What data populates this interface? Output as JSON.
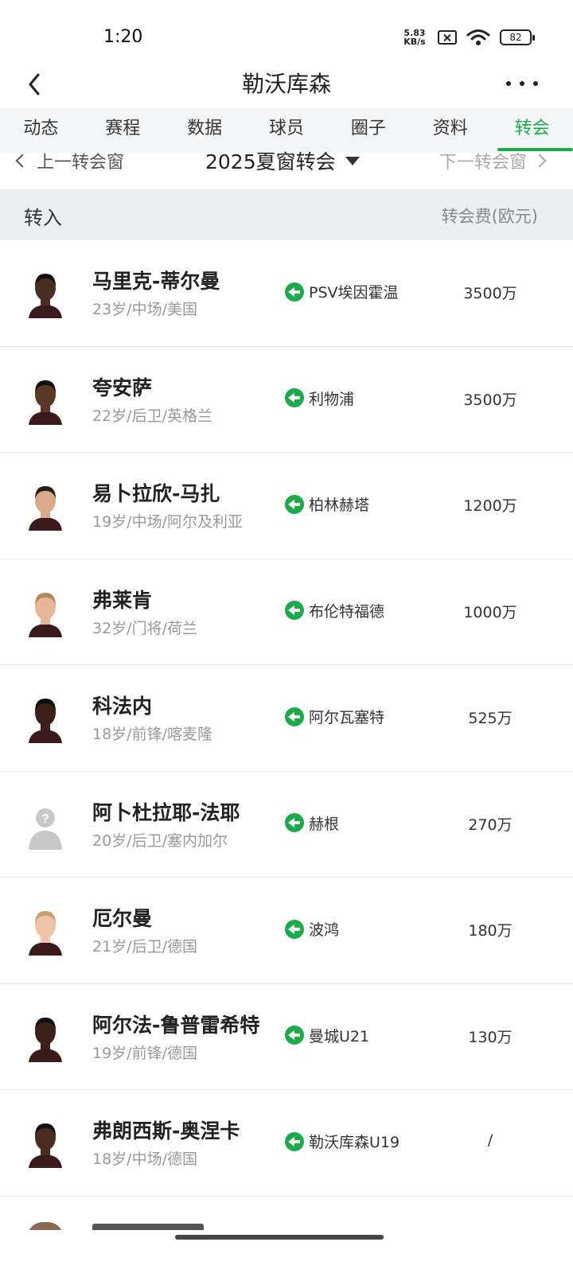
{
  "status_bar": {
    "time": "1:20",
    "net_speed_value": "5.83",
    "net_speed_unit": "KB/s",
    "battery": "82",
    "icons": [
      "sim-icon",
      "wifi-icon",
      "battery-icon"
    ]
  },
  "nav": {
    "title": "勒沃库森",
    "back_icon": "chevron-left-icon",
    "more_icon": "more-horizontal-icon"
  },
  "tabs": [
    {
      "label": "动态",
      "active": false
    },
    {
      "label": "赛程",
      "active": false
    },
    {
      "label": "数据",
      "active": false
    },
    {
      "label": "球员",
      "active": false
    },
    {
      "label": "圈子",
      "active": false
    },
    {
      "label": "资料",
      "active": false
    },
    {
      "label": "转会",
      "active": true
    }
  ],
  "window_bar": {
    "prev": "上一转会窗",
    "current": "2025夏窗转会",
    "next": "下一转会窗"
  },
  "section": {
    "title": "转入",
    "fee_header": "转会费(欧元)"
  },
  "colors": {
    "accent": "#1eaa4a",
    "tab_bg": "#f4f5f7",
    "section_bg": "#eceff2"
  },
  "transfers": [
    {
      "name": "马里克-蒂尔曼",
      "meta": "23岁/中场/美国",
      "from": "PSV埃因霍温",
      "fee": "3500万",
      "skin": "#4a2e22",
      "hair": "#111"
    },
    {
      "name": "夸安萨",
      "meta": "22岁/后卫/英格兰",
      "from": "利物浦",
      "fee": "3500万",
      "skin": "#5a3828",
      "hair": "#111"
    },
    {
      "name": "易卜拉欣-马扎",
      "meta": "19岁/中场/阿尔及利亚",
      "from": "柏林赫塔",
      "fee": "1200万",
      "skin": "#d9a98a",
      "hair": "#2a1d15"
    },
    {
      "name": "弗莱肯",
      "meta": "32岁/门将/荷兰",
      "from": "布伦特福德",
      "fee": "1000万",
      "skin": "#e8b598",
      "hair": "#b08a55"
    },
    {
      "name": "科法内",
      "meta": "18岁/前锋/喀麦隆",
      "from": "阿尔瓦塞特",
      "fee": "525万",
      "skin": "#3a2018",
      "hair": "#0d0d0d"
    },
    {
      "name": "阿卜杜拉耶-法耶",
      "meta": "20岁/后卫/塞内加尔",
      "from": "赫根",
      "fee": "270万",
      "skin": "placeholder",
      "hair": "placeholder"
    },
    {
      "name": "厄尔曼",
      "meta": "21岁/后卫/德国",
      "from": "波鸿",
      "fee": "180万",
      "skin": "#f0c2a8",
      "hair": "#c9a070"
    },
    {
      "name": "阿尔法-鲁普雷希特",
      "meta": "19岁/前锋/德国",
      "from": "曼城U21",
      "fee": "130万",
      "skin": "#3a2218",
      "hair": "#111"
    },
    {
      "name": "弗朗西斯-奥涅卡",
      "meta": "18岁/中场/德国",
      "from": "勒沃库森U19",
      "fee": "/",
      "skin": "#4a2c20",
      "hair": "#111"
    }
  ]
}
